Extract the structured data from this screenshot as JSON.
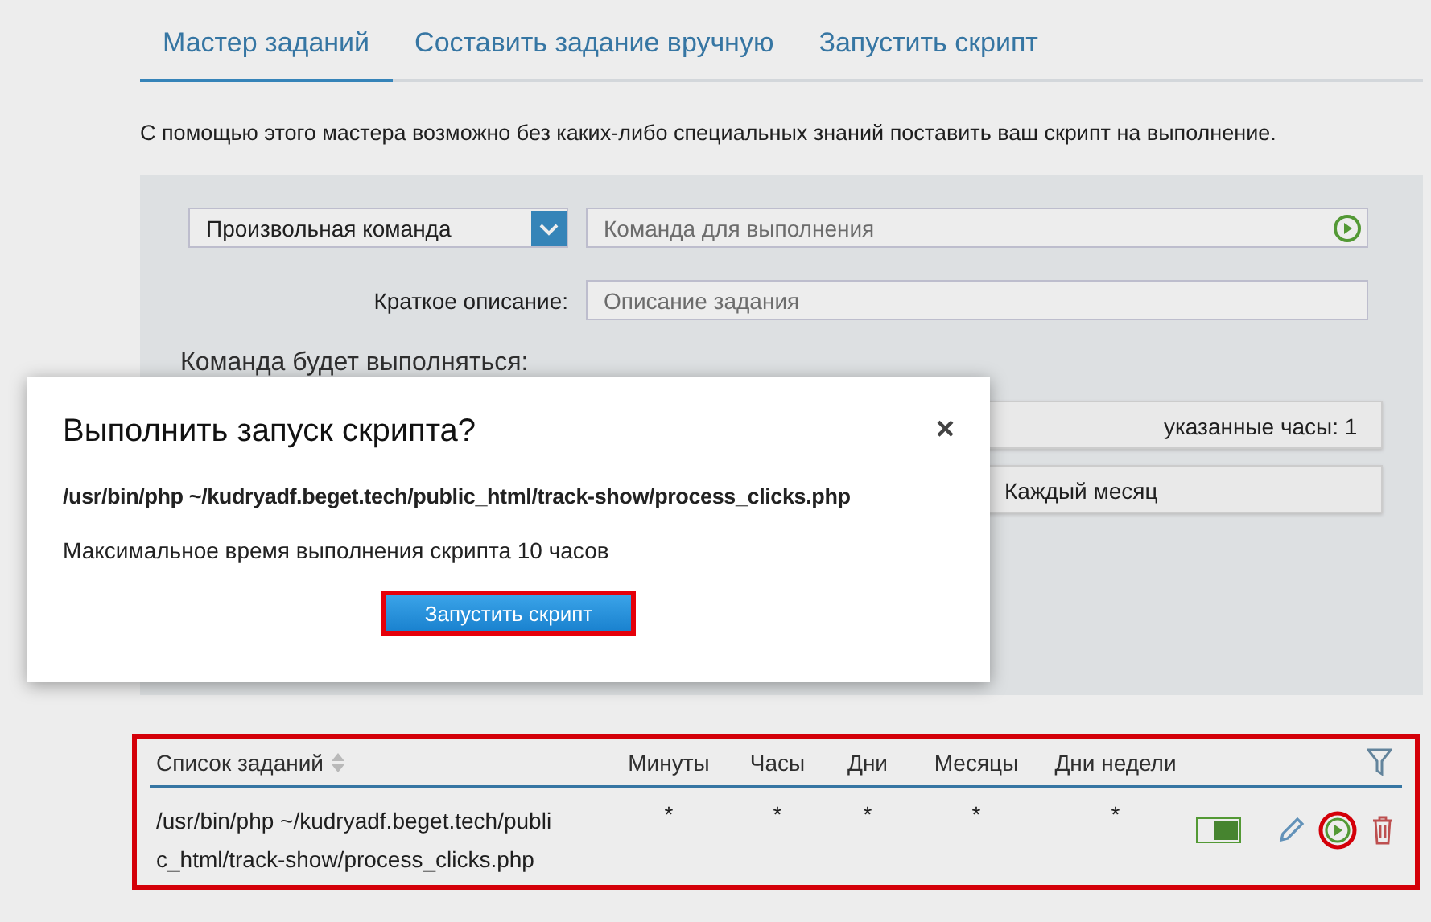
{
  "tabs": [
    {
      "label": "Мастер заданий",
      "selected": true
    },
    {
      "label": "Составить задание вручную",
      "selected": false
    },
    {
      "label": "Запустить скрипт",
      "selected": false
    }
  ],
  "intro": "С помощью этого мастера возможно без каких-либо специальных знаний поставить ваш скрипт на выполнение.",
  "form": {
    "command_type": "Произвольная команда",
    "command": {
      "placeholder": "Команда для выполнения"
    },
    "description_label": "Краткое описание:",
    "description": {
      "placeholder": "Описание задания"
    },
    "schedule_heading": "Команда будет выполняться:",
    "schedule_options": [
      "указанные часы: 1",
      "Каждый месяц"
    ]
  },
  "dialog": {
    "title": "Выполнить запуск скрипта?",
    "close": "×",
    "command": "/usr/bin/php ~/kudryadf.beget.tech/public_html/track-show/process_clicks.php",
    "note": "Максимальное время выполнения скрипта 10 часов",
    "button": "Запустить скрипт"
  },
  "table": {
    "columns": [
      "Список заданий",
      "Минуты",
      "Часы",
      "Дни",
      "Месяцы",
      "Дни недели"
    ],
    "rows": [
      {
        "cells": [
          "/usr/bin/php ~/kudryadf.beget.tech/public_html/track-show/process_clicks.php",
          "*",
          "*",
          "*",
          "*",
          "*"
        ],
        "enabled": true
      }
    ]
  }
}
